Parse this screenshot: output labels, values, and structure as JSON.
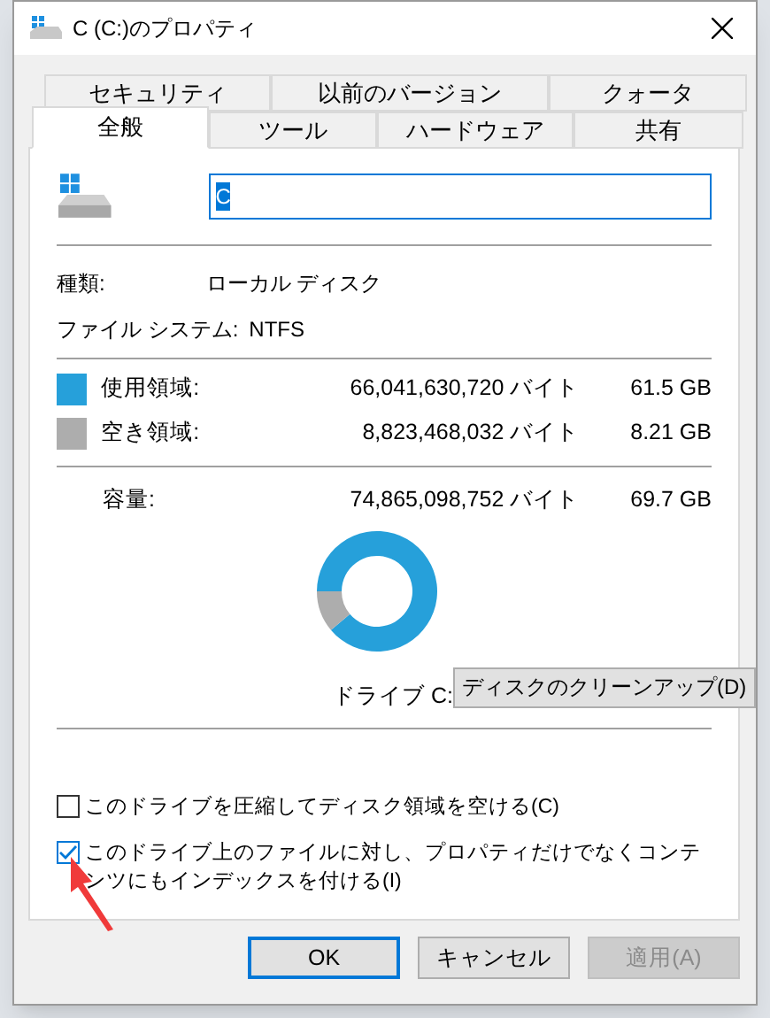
{
  "window": {
    "title": "C (C:)のプロパティ"
  },
  "tabs_back": [
    {
      "label": "セキュリティ",
      "selected": false
    },
    {
      "label": "以前のバージョン",
      "selected": false
    },
    {
      "label": "クォータ",
      "selected": false
    }
  ],
  "tabs_front": [
    {
      "label": "全般",
      "selected": true
    },
    {
      "label": "ツール",
      "selected": false
    },
    {
      "label": "ハードウェア",
      "selected": false
    },
    {
      "label": "共有",
      "selected": false
    }
  ],
  "name_field": {
    "value": "C"
  },
  "info": [
    {
      "label": "種類:",
      "value": "ローカル ディスク"
    },
    {
      "label": "ファイル システム:",
      "value": "NTFS"
    }
  ],
  "usage": [
    {
      "label": "使用領域:",
      "bytes": "66,041,630,720 バイト",
      "size": "61.5 GB",
      "color": "#26a0da"
    },
    {
      "label": "空き領域:",
      "bytes": "8,823,468,032 バイト",
      "size": "8.21 GB",
      "color": "#adadad"
    }
  ],
  "capacity": {
    "label": "容量:",
    "bytes": "74,865,098,752 バイト",
    "size": "69.7 GB"
  },
  "drive_label": "ドライブ C:",
  "cleanup_button": "ディスクのクリーンアップ(D)",
  "options": [
    {
      "label": "このドライブを圧縮してディスク領域を空ける(C)",
      "checked": false
    },
    {
      "label": "このドライブ上のファイルに対し、プロパティだけでなくコンテンツにもインデックスを付ける(I)",
      "checked": true
    }
  ],
  "buttons": [
    {
      "label": "OK",
      "kind": "default"
    },
    {
      "label": "キャンセル",
      "kind": "normal"
    },
    {
      "label": "適用(A)",
      "kind": "disabled"
    }
  ]
}
